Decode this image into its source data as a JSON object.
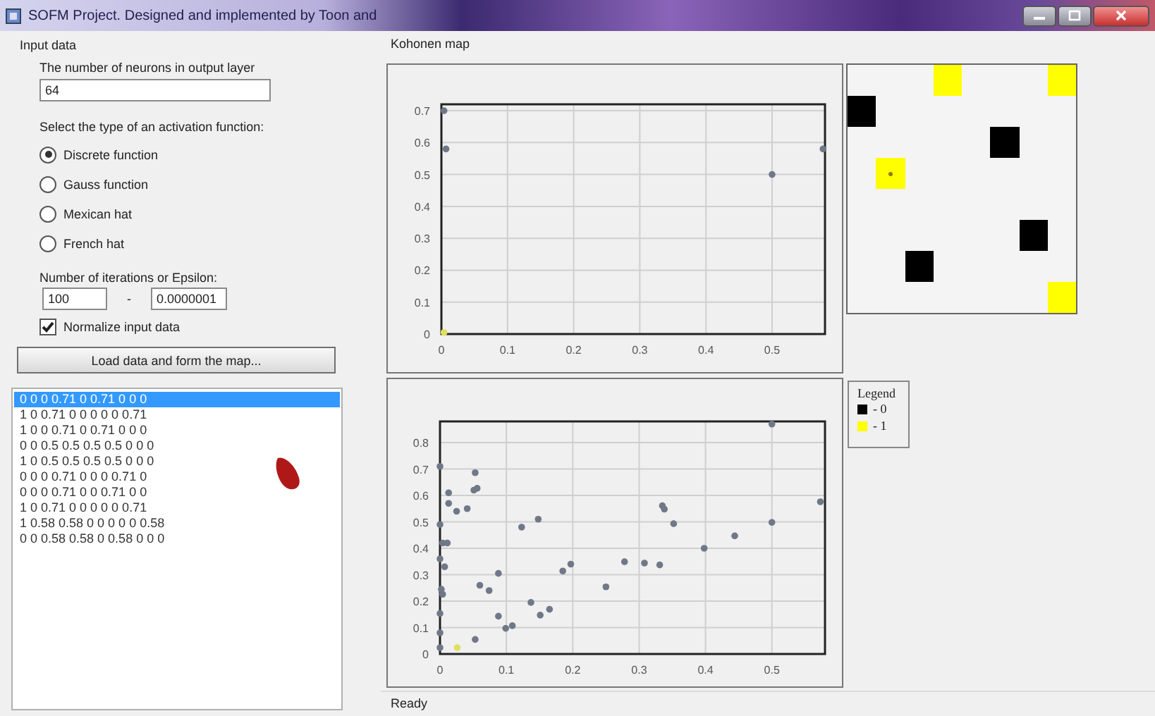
{
  "window": {
    "title": "SOFM Project. Designed and implemented by Toon and"
  },
  "input_panel": {
    "title": "Input data",
    "neurons_label": "The number of neurons in output layer",
    "neurons_value": "64",
    "activation_label": "Select the type of an activation function:",
    "activation_options": [
      {
        "label": "Discrete function",
        "selected": true
      },
      {
        "label": "Gauss function",
        "selected": false
      },
      {
        "label": "Mexican hat",
        "selected": false
      },
      {
        "label": "French hat",
        "selected": false
      }
    ],
    "iterations_label": "Number of iterations or Epsilon:",
    "iterations_value": "100",
    "separator": "-",
    "epsilon_value": "0.0000001",
    "normalize": {
      "label": "Normalize input data",
      "checked": true
    },
    "load_button": "Load data and form the map..."
  },
  "data_list": {
    "rows": [
      {
        "text": "0 0 0 0.71 0 0.71 0 0 0",
        "selected": true
      },
      {
        "text": "1 0 0.71 0 0 0 0 0 0.71",
        "selected": false
      },
      {
        "text": "1 0 0 0.71 0 0.71 0 0 0",
        "selected": false
      },
      {
        "text": "0 0 0.5 0.5 0.5 0.5 0 0 0",
        "selected": false
      },
      {
        "text": "1 0 0.5 0.5 0.5 0.5 0 0 0",
        "selected": false
      },
      {
        "text": "0 0 0 0.71 0 0 0 0.71 0",
        "selected": false
      },
      {
        "text": "0 0 0 0.71 0 0 0.71 0 0",
        "selected": false
      },
      {
        "text": "1 0 0.71 0 0 0 0 0 0.71",
        "selected": false
      },
      {
        "text": "1 0.58 0.58 0 0 0 0 0 0.58",
        "selected": false
      },
      {
        "text": "0 0 0.58 0.58 0 0.58 0 0 0",
        "selected": false
      }
    ]
  },
  "kohonen_map": {
    "title": "Kohonen map",
    "charts": [
      {
        "chart_data": {
          "type": "scatter",
          "x": [
            0.004,
            0.007,
            0.5,
            0.577,
            0.004
          ],
          "series": [
            {
              "color": "#707888",
              "values": [
                0.7,
                0.58,
                0.5,
                0.58,
                null
              ]
            },
            {
              "color": "#e0e060",
              "values": [
                null,
                null,
                null,
                null,
                0.005
              ]
            }
          ],
          "xlim": [
            0,
            0.58
          ],
          "ylim": [
            0,
            0.72
          ],
          "grid": true,
          "xticks": [
            0,
            0.1,
            0.2,
            0.3,
            0.4,
            0.5
          ],
          "yticks": [
            0,
            0.1,
            0.2,
            0.3,
            0.4,
            0.5,
            0.6,
            0.7
          ]
        }
      },
      {
        "chart_data": {
          "type": "scatter",
          "x": [
            0,
            0.053,
            0.056,
            0.051,
            0.013,
            0.013,
            0.025,
            0.041,
            0,
            0.123,
            0.148,
            0.004,
            0.011,
            0,
            0.007,
            0.088,
            0.06,
            0.074,
            0.002,
            0.004,
            0.137,
            0.088,
            0.151,
            0.165,
            0.099,
            0.109,
            0.053,
            0,
            0,
            0,
            0.185,
            0.197,
            0.25,
            0.278,
            0.308,
            0.331,
            0.335,
            0.338,
            0.352,
            0.398,
            0.444,
            0.5,
            0.5,
            0.573,
            0.026
          ],
          "series": [
            {
              "color": "#707888",
              "values": [
                0.71,
                0.686,
                0.627,
                0.62,
                0.61,
                0.57,
                0.54,
                0.55,
                0.49,
                0.48,
                0.51,
                0.42,
                0.42,
                0.36,
                0.33,
                0.305,
                0.26,
                0.24,
                0.245,
                0.226,
                0.195,
                0.143,
                0.147,
                0.169,
                0.097,
                0.107,
                0.055,
                0.153,
                0.08,
                0.024,
                0.314,
                0.34,
                0.254,
                0.349,
                0.344,
                0.337,
                0.561,
                0.548,
                0.493,
                0.4,
                0.447,
                0.498,
                0.87,
                0.576,
                null
              ]
            },
            {
              "color": "#e0e060",
              "values": [
                null,
                null,
                null,
                null,
                null,
                null,
                null,
                null,
                null,
                null,
                null,
                null,
                null,
                null,
                null,
                null,
                null,
                null,
                null,
                null,
                null,
                null,
                null,
                null,
                null,
                null,
                null,
                null,
                null,
                null,
                null,
                null,
                null,
                null,
                null,
                null,
                null,
                null,
                null,
                null,
                null,
                null,
                null,
                null,
                0.024
              ]
            }
          ],
          "xlim": [
            0,
            0.58
          ],
          "ylim": [
            0,
            0.88
          ],
          "grid": true,
          "xticks": [
            0,
            0.1,
            0.2,
            0.3,
            0.4,
            0.5
          ],
          "yticks": [
            0,
            0.1,
            0.2,
            0.3,
            0.4,
            0.5,
            0.6,
            0.7,
            0.8
          ]
        }
      }
    ],
    "grid": [
      {
        "cells": [
          {
            "kind": "empty"
          },
          {
            "kind": "empty"
          },
          {
            "kind": "empty"
          },
          {
            "kind": "one"
          },
          {
            "kind": "empty"
          },
          {
            "kind": "empty"
          },
          {
            "kind": "empty"
          },
          {
            "kind": "one"
          }
        ]
      },
      {
        "cells": [
          {
            "kind": "zero"
          },
          {
            "kind": "empty"
          },
          {
            "kind": "empty"
          },
          {
            "kind": "empty"
          },
          {
            "kind": "empty"
          },
          {
            "kind": "empty"
          },
          {
            "kind": "empty"
          },
          {
            "kind": "empty"
          }
        ]
      },
      {
        "cells": [
          {
            "kind": "empty"
          },
          {
            "kind": "empty"
          },
          {
            "kind": "empty"
          },
          {
            "kind": "empty"
          },
          {
            "kind": "empty"
          },
          {
            "kind": "zero"
          },
          {
            "kind": "empty"
          },
          {
            "kind": "empty"
          }
        ]
      },
      {
        "cells": [
          {
            "kind": "empty"
          },
          {
            "kind": "winner"
          },
          {
            "kind": "empty"
          },
          {
            "kind": "empty"
          },
          {
            "kind": "empty"
          },
          {
            "kind": "empty"
          },
          {
            "kind": "empty"
          },
          {
            "kind": "empty"
          }
        ]
      },
      {
        "cells": [
          {
            "kind": "empty"
          },
          {
            "kind": "empty"
          },
          {
            "kind": "empty"
          },
          {
            "kind": "empty"
          },
          {
            "kind": "empty"
          },
          {
            "kind": "empty"
          },
          {
            "kind": "empty"
          },
          {
            "kind": "empty"
          }
        ]
      },
      {
        "cells": [
          {
            "kind": "empty"
          },
          {
            "kind": "empty"
          },
          {
            "kind": "empty"
          },
          {
            "kind": "empty"
          },
          {
            "kind": "empty"
          },
          {
            "kind": "empty"
          },
          {
            "kind": "zero"
          },
          {
            "kind": "empty"
          }
        ]
      },
      {
        "cells": [
          {
            "kind": "empty"
          },
          {
            "kind": "empty"
          },
          {
            "kind": "zero"
          },
          {
            "kind": "empty"
          },
          {
            "kind": "empty"
          },
          {
            "kind": "empty"
          },
          {
            "kind": "empty"
          },
          {
            "kind": "empty"
          }
        ]
      },
      {
        "cells": [
          {
            "kind": "empty"
          },
          {
            "kind": "empty"
          },
          {
            "kind": "empty"
          },
          {
            "kind": "empty"
          },
          {
            "kind": "empty"
          },
          {
            "kind": "empty"
          },
          {
            "kind": "empty"
          },
          {
            "kind": "one"
          }
        ]
      }
    ],
    "legend": {
      "title": "Legend",
      "items": [
        {
          "label": "- 0",
          "color": "#000000"
        },
        {
          "label": "- 1",
          "color": "#ffff00"
        }
      ]
    }
  },
  "status_bar": {
    "text": "Ready"
  }
}
